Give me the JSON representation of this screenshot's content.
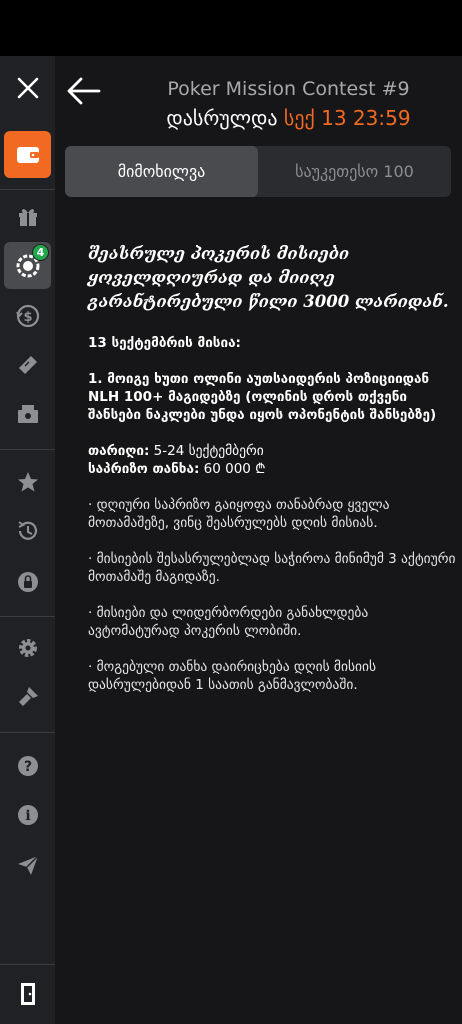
{
  "header": {
    "title": "Poker Mission Contest #9",
    "status_label": "დასრულდა",
    "end_date": "სექ 13 23:59"
  },
  "tabs": [
    {
      "label": "მიმოხილვა",
      "active": true
    },
    {
      "label": "საუკეთესო 100",
      "active": false
    }
  ],
  "sidebar": {
    "items": [
      {
        "icon": "close-icon"
      },
      {
        "icon": "wallet-icon",
        "active": true
      },
      {
        "icon": "gift-icon"
      },
      {
        "icon": "missions-icon",
        "badge": "4"
      },
      {
        "icon": "cashback-icon"
      },
      {
        "icon": "ticket-icon"
      },
      {
        "icon": "cash-register-icon"
      },
      {
        "icon": "star-icon"
      },
      {
        "icon": "history-icon"
      },
      {
        "icon": "lock-icon"
      },
      {
        "icon": "gear-icon"
      },
      {
        "icon": "brush-icon"
      },
      {
        "icon": "help-icon"
      },
      {
        "icon": "info-icon"
      },
      {
        "icon": "send-icon"
      },
      {
        "icon": "logout-icon"
      }
    ]
  },
  "content": {
    "intro": "შეასრულე პოკერის მისიები ყოველდღიურად და მიიღე გარანტირებული წილი 3000 ლარიდან.",
    "mission_heading": "13 სექტემბრის მისია:",
    "mission_text": "1. მოიგე ხუთი ოლინი აუთსაიდერის პოზიციიდან NLH 100+ მაგიდებზე (ოლინის დროს თქვენი შანსები ნაკლები უნდა იყოს ოპონენტის შანსებზე)",
    "date_label": "თარიღი:",
    "date_value": " 5-24 სექტემბერი",
    "prize_label": "საპრიზო თანხა:",
    "prize_value": " 60 000 ₾",
    "rule1": "· დღიური საპრიზო გაიყოფა თანაბრად ყველა მოთამაშეზე, ვინც შეასრულებს დღის მისიას.",
    "rule2": "· მისიების შესასრულებლად საჭიროა მინიმუმ 3 აქტიური მოთამაშე მაგიდაზე.",
    "rule3": "· მისიები და ლიდერბორდები განახლდება ავტომატურად პოკერის ლობიში.",
    "rule4": "· მოგებული თანხა დაირიცხება დღის მისიის დასრულებიდან 1 საათის განმავლობაში."
  },
  "colors": {
    "accent": "#f26a21",
    "sidebar_bg": "#202124",
    "main_bg": "#161618",
    "badge": "#22a74a"
  }
}
